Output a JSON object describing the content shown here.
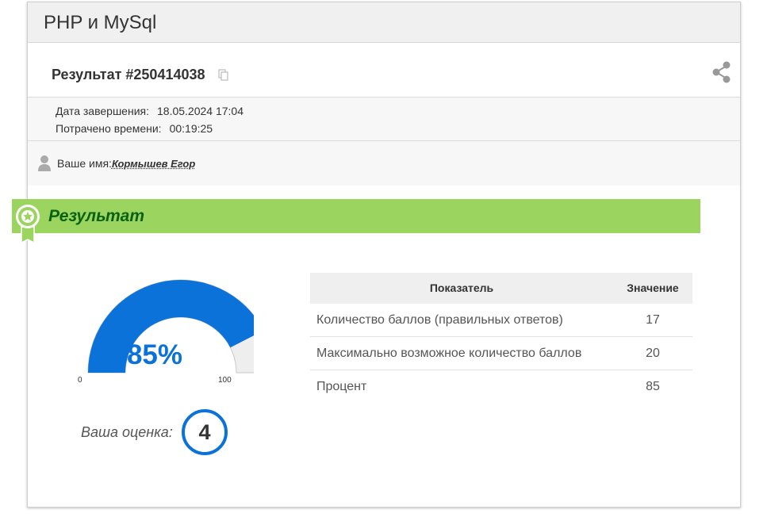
{
  "header": {
    "title": "PHP и MySql"
  },
  "result": {
    "title": "Результат #250414038",
    "copy_icon": "copy-icon",
    "share_icon": "share-icon"
  },
  "meta": {
    "finish_label": "Дата завершения:",
    "finish_value": "18.05.2024 17:04",
    "time_label": "Потрачено времени:",
    "time_value": "00:19:25"
  },
  "user": {
    "label": "Ваше имя:",
    "value": "Кормышев Егор",
    "icon": "user-icon"
  },
  "banner": {
    "label": "Результат",
    "icon": "award-badge-icon",
    "color": "#9bd45f"
  },
  "gauge": {
    "percent_label": "85%",
    "percent": 85,
    "min": "0",
    "max": "100",
    "fill_color": "#0a72d8",
    "track_color": "#eeeeee"
  },
  "grade": {
    "label": "Ваша оценка:",
    "value": "4"
  },
  "table": {
    "headers": [
      "Показатель",
      "Значение"
    ],
    "rows": [
      {
        "name": "Количество баллов (правильных ответов)",
        "value": "17"
      },
      {
        "name": "Максимально возможное количество баллов",
        "value": "20"
      },
      {
        "name": "Процент",
        "value": "85"
      }
    ]
  }
}
